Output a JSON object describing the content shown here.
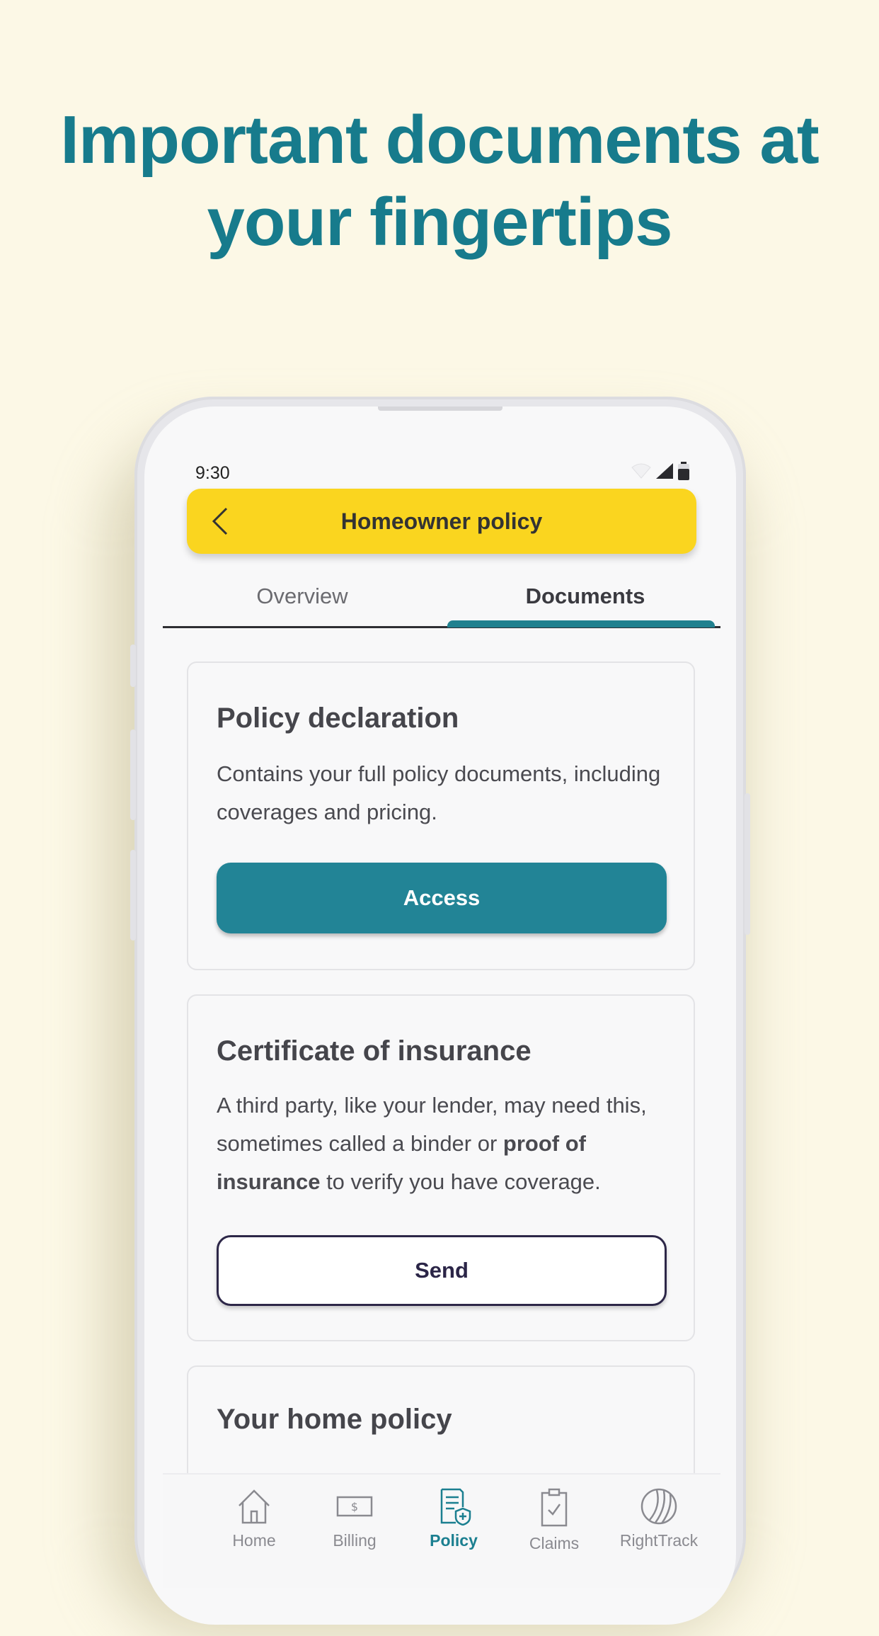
{
  "headline": {
    "line1": "Important documents at",
    "line2": "your fingertips"
  },
  "status_bar": {
    "time": "9:30",
    "icons": [
      "wifi-icon",
      "signal-icon",
      "battery-icon"
    ]
  },
  "app_bar": {
    "title": "Homeowner policy",
    "back_icon": "chevron-left-icon"
  },
  "tabs": [
    {
      "label": "Overview",
      "selected": false
    },
    {
      "label": "Documents",
      "selected": true
    }
  ],
  "cards": [
    {
      "title": "Policy declaration",
      "body": "Contains your full policy documents, including coverages and pricing.",
      "button": "Access"
    },
    {
      "title": "Certificate of insurance",
      "body_prefix": "A third party, like your lender, may need this, sometimes called a binder or ",
      "body_bold": "proof of insurance",
      "body_suffix": " to verify you have coverage.",
      "button": "Send"
    },
    {
      "title": "Your home policy"
    }
  ],
  "bottom_nav": [
    {
      "label": "Home",
      "icon": "home-icon",
      "active": false
    },
    {
      "label": "Billing",
      "icon": "billing-icon",
      "active": false
    },
    {
      "label": "Policy",
      "icon": "policy-icon",
      "active": true
    },
    {
      "label": "Claims",
      "icon": "claims-icon",
      "active": false
    },
    {
      "label": "RightTrack",
      "icon": "righttrack-icon",
      "active": false
    }
  ],
  "colors": {
    "background": "#fcf8e6",
    "headline": "#177b8c",
    "app_bar": "#fad51f",
    "primary_button": "#228496",
    "active_nav": "#1b7f90"
  }
}
